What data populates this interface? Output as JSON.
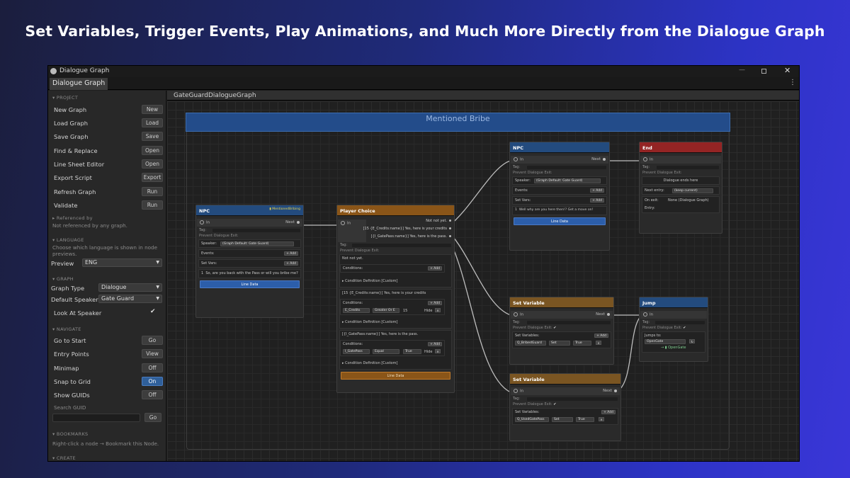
{
  "headline": "Set Variables, Trigger Events, Play Animations, and Much More Directly from the Dialogue Graph",
  "window": {
    "title": "Dialogue Graph",
    "tab": "Dialogue Graph",
    "minimize": "—",
    "close": "✕",
    "menu": "⋮"
  },
  "sidebar": {
    "project_header": "▾ PROJECT",
    "project_items": [
      {
        "label": "New Graph",
        "button": "New"
      },
      {
        "label": "Load Graph",
        "button": "Load"
      },
      {
        "label": "Save Graph",
        "button": "Save"
      },
      {
        "label": "Find & Replace",
        "button": "Open"
      },
      {
        "label": "Line Sheet Editor",
        "button": "Open"
      },
      {
        "label": "Export Script",
        "button": "Export"
      },
      {
        "label": "Refresh Graph",
        "button": "Run"
      },
      {
        "label": "Validate",
        "button": "Run"
      }
    ],
    "referenced_header": "▸ Referenced by",
    "referenced_note": "Not referenced by any graph.",
    "language_header": "▾ LANGUAGE",
    "language_note": "Choose which language is shown in node previews.",
    "preview_label": "Preview",
    "preview_value": "ENG",
    "graph_header": "▾ GRAPH",
    "graph_type_label": "Graph Type",
    "graph_type_value": "Dialogue",
    "default_speaker_label": "Default Speaker",
    "default_speaker_value": "Gate Guard",
    "look_at_label": "Look At Speaker",
    "look_at_check": "✔",
    "navigate_header": "▾ NAVIGATE",
    "navigate_items": [
      {
        "label": "Go to Start",
        "button": "Go",
        "on": false
      },
      {
        "label": "Entry Points",
        "button": "View",
        "on": false
      },
      {
        "label": "Minimap",
        "button": "Off",
        "on": false
      },
      {
        "label": "Snap to Grid",
        "button": "On",
        "on": true
      },
      {
        "label": "Show GUIDs",
        "button": "Off",
        "on": false
      }
    ],
    "search_guid_label": "Search GUID",
    "search_guid_button": "Go",
    "bookmarks_header": "▾ BOOKMARKS",
    "bookmarks_note": "Right-click a node → Bookmark this Node.",
    "create_header": "▾ CREATE"
  },
  "graph": {
    "name": "GateGuardDialogueGraph",
    "group_title": "Mentioned Bribe",
    "npc1": {
      "header": "NPC",
      "tag": "▮ MentionedBribing",
      "in": "In",
      "next": "Next",
      "tag_label": "Tag:",
      "prevent": "Prevent Dialogue Exit:",
      "speaker_label": "Speaker:",
      "speaker_value": "(Graph Default: Gate Guard)",
      "events_label": "Events:",
      "set_vars_label": "Set Vars:",
      "add": "+ Add",
      "line_num": "1",
      "line_text": "So, are you back with the Pass or will you bribe me?",
      "line_data": "Line Data"
    },
    "choice": {
      "header": "Player Choice",
      "in": "In",
      "options": [
        "Not not yet.",
        "[15 {E_Credits:name}] Yes, here is your credits",
        "[{I_GatePass:name}] Yes, here is the pass."
      ],
      "tag_label": "Tag:",
      "prevent": "Prevent Dialogue Exit:",
      "c1_text": "Not not yet.",
      "conditions": "Conditions:",
      "add": "+ Add",
      "cond_def": "▸ Condition Definition [Custom]",
      "c2_text": "[15 {E_Credits:name}] Yes, here is your credits",
      "c2_var": "E_Credits",
      "c2_op": "Greater Or E",
      "c2_val": "15",
      "hide": "Hide",
      "c3_text": "[{I_GatePass:name}] Yes, here is the pass.",
      "c3_var": "I_GatePass",
      "c3_op": "Equal",
      "c3_val": "True",
      "x": "✕",
      "line_data": "Line Data"
    },
    "npc2": {
      "header": "NPC",
      "in": "In",
      "next": "Next",
      "tag_label": "Tag:",
      "prevent": "Prevent Dialogue Exit:",
      "speaker_label": "Speaker:",
      "speaker_value": "(Graph Default: Gate Guard)",
      "events_label": "Events:",
      "set_vars_label": "Set Vars:",
      "add": "+ Add",
      "line_num": "1",
      "line_text": "Well why are you here then!? Get a move on!",
      "line_data": "Line Data"
    },
    "end": {
      "header": "End",
      "in": "In",
      "tag_label": "Tag:",
      "prevent": "Prevent Dialogue Exit:",
      "ends_text": "Dialogue ends here",
      "next_entry_label": "Next entry:",
      "next_entry_value": "(keep current)",
      "on_exit_label": "On exit:",
      "on_exit_value": "None (Dialogue Graph)",
      "entry_label": "Entry:"
    },
    "setvar1": {
      "header": "Set Variable",
      "in": "In",
      "next": "Next",
      "tag_label": "Tag:",
      "prevent": "Prevent Dialogue Exit:",
      "check": "✔",
      "set_vars_label": "Set Variables:",
      "add": "+ Add",
      "var": "Q_BribedGuard",
      "op": "Set",
      "val": "True",
      "x": "✕"
    },
    "setvar2": {
      "header": "Set Variable",
      "in": "In",
      "next": "Next",
      "tag_label": "Tag:",
      "prevent": "Prevent Dialogue Exit:",
      "check": "✔",
      "set_vars_label": "Set Variables:",
      "add": "+ Add",
      "var": "Q_UsedGatePass",
      "op": "Set",
      "val": "True",
      "x": "✕"
    },
    "jump": {
      "header": "Jump",
      "in": "In",
      "tag_label": "Tag:",
      "prevent": "Prevent Dialogue Exit:",
      "check": "✔",
      "jumps_to": "Jumps to:",
      "target": "OpenGate",
      "link": "→ ▮ OpenGate"
    }
  }
}
